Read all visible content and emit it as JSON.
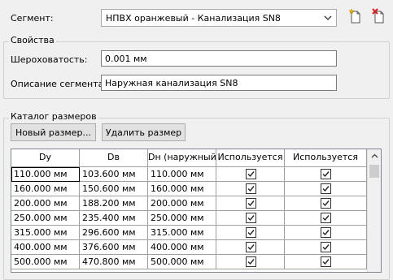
{
  "segment": {
    "label": "Сегмент:",
    "value": "НПВХ оранжевый - Канализация SN8"
  },
  "toolbar": {
    "new_segment_icon": "new-document-icon",
    "delete_segment_icon": "delete-document-icon"
  },
  "properties": {
    "title": "Свойства",
    "roughness_label": "Шероховатость:",
    "roughness_value": "0.001 мм",
    "description_label": "Описание сегмента:",
    "description_value": "Наружная канализация SN8"
  },
  "catalog": {
    "title": "Каталог размеров",
    "new_size_label": "Новый размер...",
    "delete_size_label": "Удалить размер",
    "columns": [
      "Dy",
      "Dв",
      "Dн (наружный",
      "Используется",
      "Используется"
    ],
    "rows": [
      {
        "dy": "110.000 мм",
        "dv": "103.600 мм",
        "dn": "110.000 мм",
        "used1": true,
        "used2": true
      },
      {
        "dy": "160.000 мм",
        "dv": "150.600 мм",
        "dn": "160.000 мм",
        "used1": true,
        "used2": true
      },
      {
        "dy": "200.000 мм",
        "dv": "188.200 мм",
        "dn": "200.000 мм",
        "used1": true,
        "used2": true
      },
      {
        "dy": "250.000 мм",
        "dv": "235.400 мм",
        "dn": "250.000 мм",
        "used1": true,
        "used2": true
      },
      {
        "dy": "315.000 мм",
        "dv": "296.600 мм",
        "dn": "315.000 мм",
        "used1": true,
        "used2": true
      },
      {
        "dy": "400.000 мм",
        "dv": "376.600 мм",
        "dn": "400.000 мм",
        "used1": true,
        "used2": true
      },
      {
        "dy": "500.000 мм",
        "dv": "470.800 мм",
        "dn": "500.000 мм",
        "used1": true,
        "used2": true
      }
    ]
  },
  "colors": {
    "window_bg": "#f0f0f0",
    "grid_line": "#a0a0a0",
    "button_bg": "#e1e1e1"
  }
}
